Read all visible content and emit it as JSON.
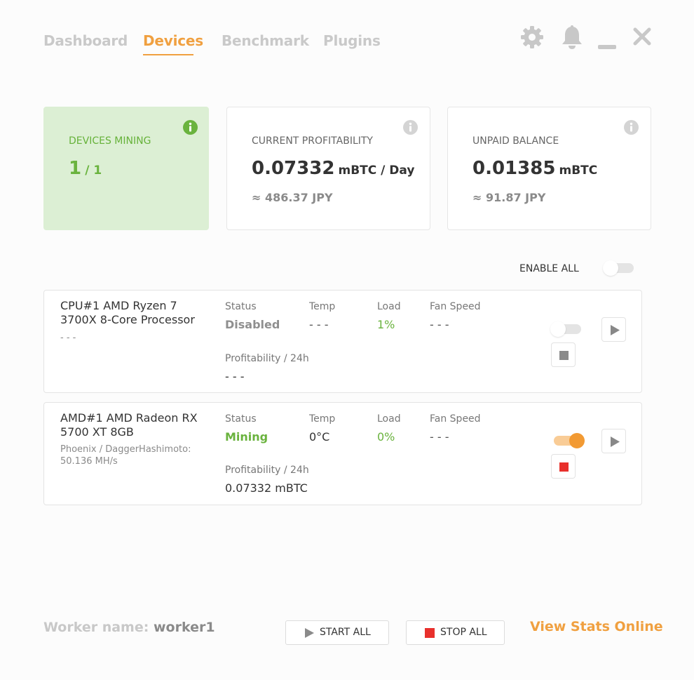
{
  "nav": {
    "tabs": [
      {
        "label": "Dashboard"
      },
      {
        "label": "Devices"
      },
      {
        "label": "Benchmark"
      },
      {
        "label": "Plugins"
      }
    ],
    "active_tab": "Devices"
  },
  "window_icons": [
    "gear-icon",
    "bell-icon",
    "minimize-icon",
    "close-icon"
  ],
  "colors": {
    "accent": "#f0a040",
    "green": "#6ab33e",
    "green_card_bg": "#dcefd4",
    "stop_red": "#e8302c"
  },
  "stats": {
    "devices_mining": {
      "label": "DEVICES MINING",
      "count": "1",
      "total": "/ 1"
    },
    "profitability": {
      "label": "CURRENT PROFITABILITY",
      "value": "0.07332",
      "unit": "mBTC / Day",
      "fiat": "≈ 486.37 JPY"
    },
    "balance": {
      "label": "UNPAID BALANCE",
      "value": "0.01385",
      "unit": "mBTC",
      "fiat": "≈ 91.87 JPY"
    }
  },
  "enable_all": {
    "label": "ENABLE ALL",
    "enabled": false
  },
  "columns": {
    "status": "Status",
    "temp": "Temp",
    "load": "Load",
    "fan": "Fan Speed",
    "profit": "Profitability / 24h"
  },
  "devices": [
    {
      "name": "CPU#1 AMD Ryzen 7 3700X 8-Core Processor",
      "algo": "- - -",
      "status": "Disabled",
      "temp": "- - -",
      "load": "1%",
      "fan": "- - -",
      "profit": "- - -",
      "enabled": false
    },
    {
      "name": "AMD#1 AMD Radeon RX 5700 XT 8GB",
      "algo": "Phoenix / DaggerHashimoto: 50.136 MH/s",
      "status": "Mining",
      "temp": "0°C",
      "load": "0%",
      "fan": "- - -",
      "profit": "0.07332 mBTC",
      "enabled": true
    }
  ],
  "footer": {
    "worker_label": "Worker name:",
    "worker_name": "worker1",
    "start_all": "START ALL",
    "stop_all": "STOP ALL",
    "view_stats": "View Stats Online"
  }
}
